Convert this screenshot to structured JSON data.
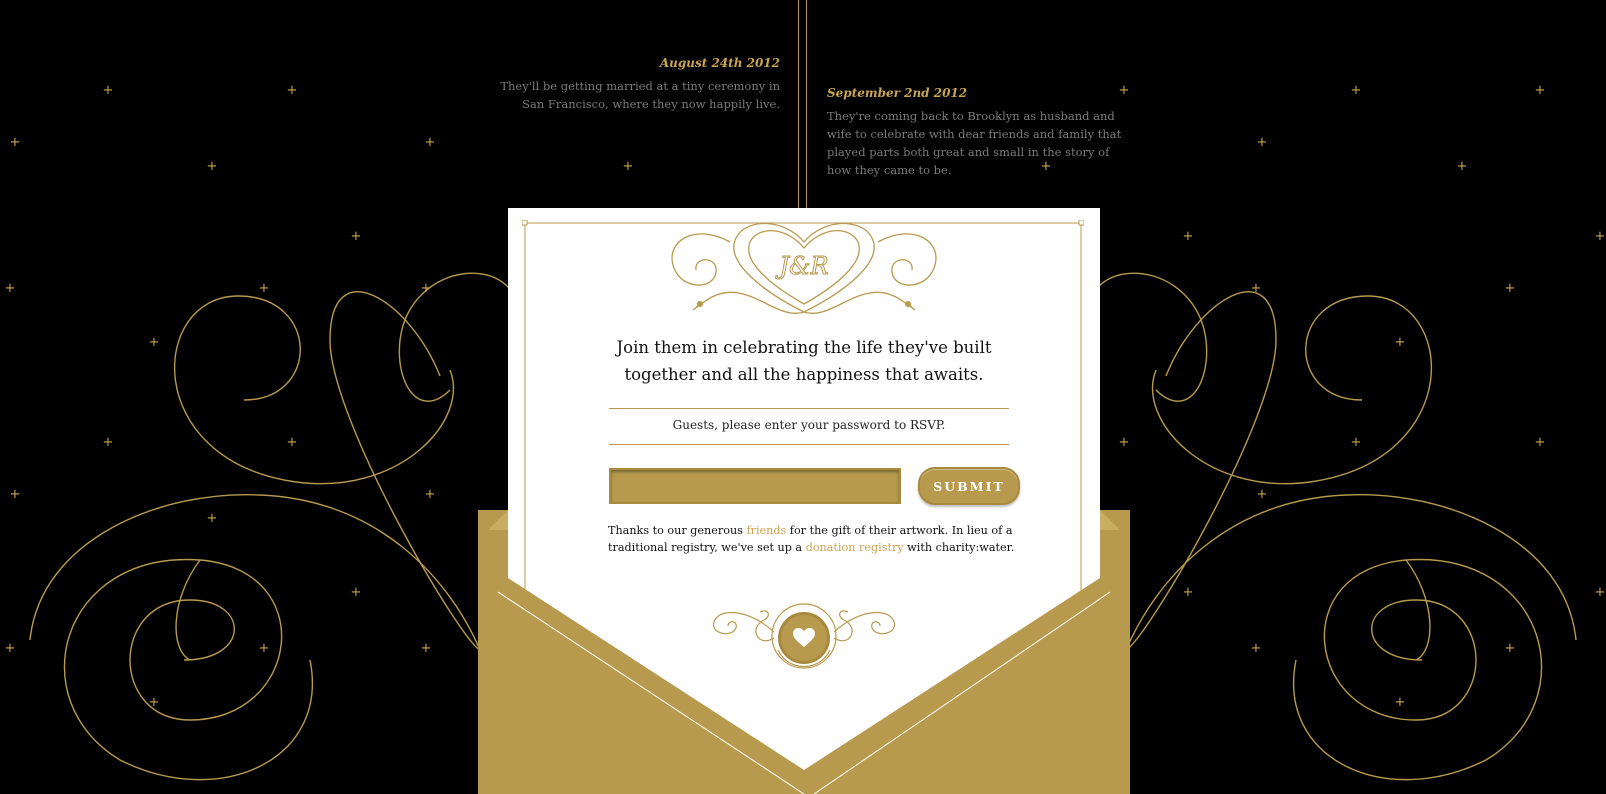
{
  "timeline": {
    "events": [
      {
        "date": "August 24th 2012",
        "text": "They'll be getting married at a tiny ceremony in San Francisco, where they now happily live."
      },
      {
        "date": "September 2nd 2012",
        "text": "They're coming back to Brooklyn as husband and wife to celebrate with dear friends and family that played parts both great and small in the story of how they came to be."
      }
    ]
  },
  "card": {
    "monogram": "J&R",
    "headline_line1": "Join them in celebrating the life they've built",
    "headline_line2": "together and all the happiness that awaits.",
    "rsvp_prompt": "Guests, please enter your password to RSVP.",
    "password": {
      "value": "",
      "placeholder": ""
    },
    "submit_label": "SUBMIT",
    "thanks": {
      "prefix": "Thanks to our generous ",
      "friends_link": "friends",
      "middle": " for the gift of their artwork. In lieu of a traditional registry, we've set up a ",
      "registry_link": "donation registry",
      "suffix": " with charity:water."
    }
  },
  "icons": [
    "heart-icon",
    "monogram-heart-icon",
    "star-icon",
    "flourish-icon"
  ],
  "colors": {
    "background": "#000000",
    "gold": "#b89a4e",
    "gold_light": "#c9a452",
    "card": "#ffffff",
    "muted_text": "#7b7b7b"
  }
}
